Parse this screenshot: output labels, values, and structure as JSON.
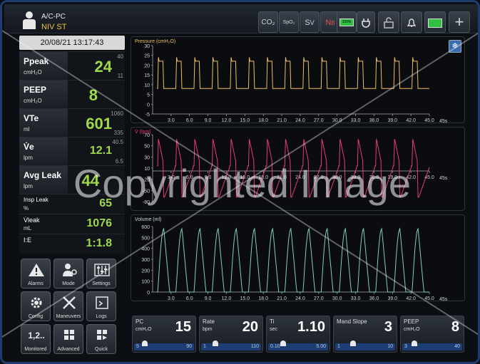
{
  "header": {
    "mode_primary": "A/C-PC",
    "mode_secondary": "NIV ST",
    "tray_icons": [
      "CO2",
      "SpO2",
      "SV",
      "NB",
      "100%"
    ],
    "battery_label": "100%"
  },
  "datetime": "20/08/21  13:17:43",
  "parameters": [
    {
      "name": "Ppeak",
      "unit": "cmH₂O",
      "value": "24",
      "hi": "40",
      "lo": "11"
    },
    {
      "name": "PEEP",
      "unit": "cmH₂O",
      "value": "8",
      "hi": "",
      "lo": ""
    },
    {
      "name": "VTe",
      "unit": "ml",
      "value": "601",
      "hi": "1060",
      "lo": "335"
    },
    {
      "name": "V̇e",
      "unit": "lpm",
      "value": "12.1",
      "hi": "40.5",
      "lo": "6.5"
    },
    {
      "name": "Avg Leak",
      "unit": "lpm",
      "value": "44",
      "hi": "",
      "lo": ""
    },
    {
      "name": "Insp Leak",
      "unit": "%",
      "value": "65",
      "hi": "",
      "lo": ""
    },
    {
      "name": "V̇leak",
      "unit": "mL",
      "value": "1076",
      "hi": "",
      "lo": ""
    },
    {
      "name": "I:E",
      "unit": "",
      "value": "1:1.8",
      "hi": "",
      "lo": ""
    }
  ],
  "menu": [
    {
      "label": "Alarms",
      "icon": "warning-icon"
    },
    {
      "label": "Mode",
      "icon": "patient-mode-icon"
    },
    {
      "label": "Settings",
      "icon": "sliders-icon"
    },
    {
      "label": "Config",
      "icon": "gear-icon"
    },
    {
      "label": "Maneuvers",
      "icon": "tools-icon"
    },
    {
      "label": "Logs",
      "icon": "logs-icon"
    },
    {
      "label": "Monitored",
      "icon": "monitored-icon"
    },
    {
      "label": "Advanced",
      "icon": "grid-icon"
    },
    {
      "label": "Quick",
      "icon": "quick-icon"
    }
  ],
  "waveforms": {
    "pressure": {
      "title": "Pressure (cmH₂O)",
      "color": "#f0c060",
      "yticks": [
        "30",
        "25",
        "20",
        "15",
        "10",
        "5",
        "0",
        "-5"
      ],
      "xticks": [
        "3.0",
        "6.0",
        "9.0",
        "12.0",
        "15.0",
        "18.0",
        "21.0",
        "24.0",
        "27.0",
        "30.0",
        "33.0",
        "36.0",
        "39.0",
        "42.0",
        "45.0"
      ],
      "xunit": "45s"
    },
    "flow": {
      "title": "V̇ (lpm)",
      "color": "#e83c78",
      "yticks": [
        "70",
        "50",
        "30",
        "10",
        "-20",
        "-50",
        "-80"
      ],
      "xticks": [
        "3.0",
        "6.0",
        "9.0",
        "12.0",
        "15.0",
        "18.0",
        "21.0",
        "24.0",
        "27.0",
        "30.0",
        "33.0",
        "36.0",
        "39.0",
        "42.0",
        "45.0"
      ],
      "xunit": "45s"
    },
    "volume": {
      "title": "Volume (ml)",
      "color": "#80d0b8",
      "yticks": [
        "600",
        "500",
        "400",
        "300",
        "200",
        "100",
        "0"
      ],
      "xticks": [
        "3.0",
        "6.0",
        "9.0",
        "12.0",
        "15.0",
        "18.0",
        "21.0",
        "24.0",
        "27.0",
        "30.0",
        "33.0",
        "36.0",
        "39.0",
        "42.0",
        "45.0"
      ],
      "xunit": "45s"
    }
  },
  "controls": [
    {
      "name": "PC",
      "unit": "cmH₂O",
      "value": "15",
      "min": "5",
      "max": "90",
      "level": 0.12
    },
    {
      "name": "Rate",
      "unit": "bpm",
      "value": "20",
      "min": "1",
      "max": "110",
      "level": 0.18
    },
    {
      "name": "Ti",
      "unit": "sec",
      "value": "1.10",
      "min": "0.10",
      "max": "5.00",
      "level": 0.2
    },
    {
      "name": "Mand Slope",
      "unit": "",
      "value": "3",
      "min": "1",
      "max": "10",
      "level": 0.25
    },
    {
      "name": "PEEP",
      "unit": "cmH₂O",
      "value": "8",
      "min": "3",
      "max": "40",
      "level": 0.15
    }
  ],
  "watermark": "Copyrighted Image"
}
